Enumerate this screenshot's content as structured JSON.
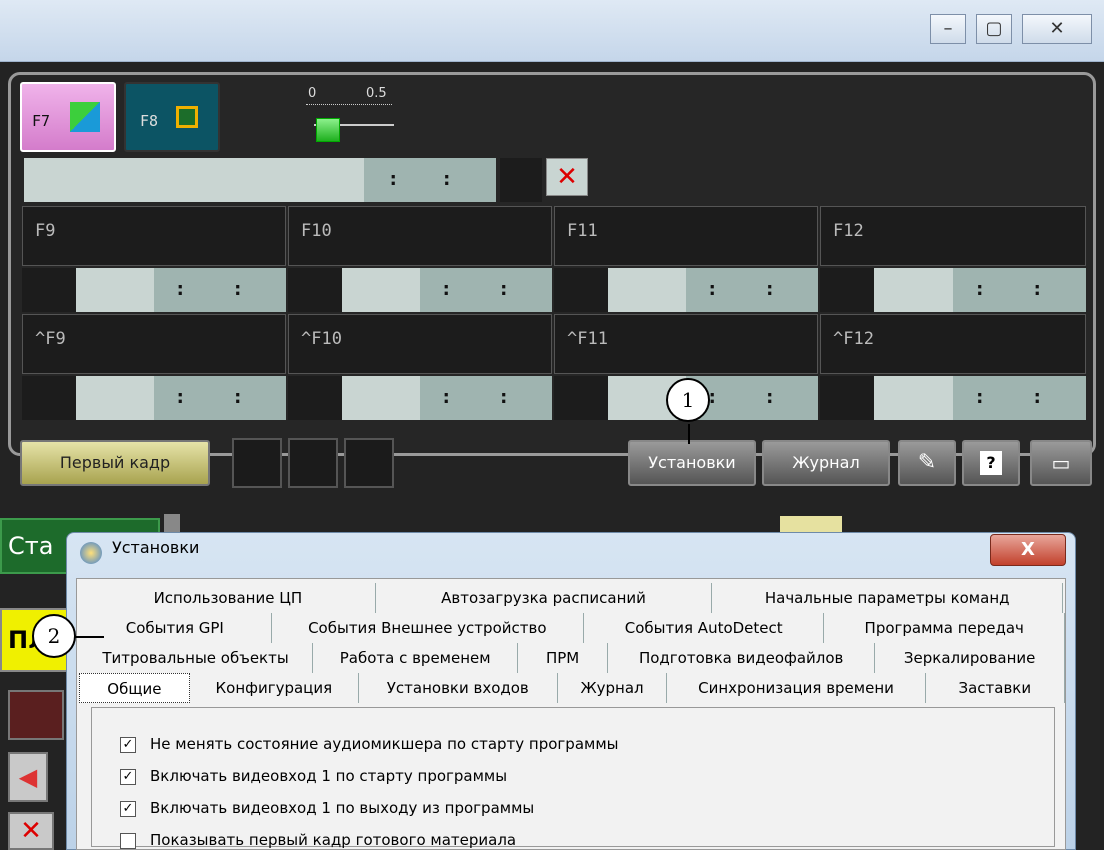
{
  "window": {
    "controls": [
      "–",
      "▢",
      "✕"
    ]
  },
  "toolbar": {
    "f7_label": "F7",
    "f8_label": "F8",
    "slider": {
      "min_label": "0",
      "max_label": "0.5",
      "level": 0.0
    }
  },
  "main_timer": ": :",
  "slots": [
    {
      "label": "F9"
    },
    {
      "label": "F10"
    },
    {
      "label": "F11"
    },
    {
      "label": "F12"
    },
    {
      "label": "^F9"
    },
    {
      "label": "^F10"
    },
    {
      "label": "^F11"
    },
    {
      "label": "^F12"
    }
  ],
  "slot_timer": ": :",
  "bottom_bar": {
    "first_frame": "Первый кадр",
    "settings": "Установки",
    "journal": "Журнал",
    "help": "?"
  },
  "left_fragments": {
    "sta": "Ста",
    "pl": "Пл"
  },
  "dialog": {
    "title": "Установки",
    "close": "X",
    "tab_rows": [
      [
        "Использование ЦП",
        "Автозагрузка расписаний",
        "Начальные параметры команд"
      ],
      [
        "События GPI",
        "События Внешнее устройство",
        "События AutoDetect",
        "Программа передач"
      ],
      [
        "Титровальные объекты",
        "Работа с временем",
        "ПРМ",
        "Подготовка видеофайлов",
        "Зеркалирование"
      ],
      [
        "Общие",
        "Конфигурация",
        "Установки входов",
        "Журнал",
        "Синхронизация времени",
        "Заставки"
      ]
    ],
    "options": [
      {
        "label": "Не менять состояние аудиомикшера по старту программы",
        "checked": true
      },
      {
        "label": "Включать видеовход 1 по старту программы",
        "checked": true
      },
      {
        "label": "Включать видеовход 1 по выходу из программы",
        "checked": true
      },
      {
        "label": "Показывать первый кадр готового материала",
        "checked": false
      }
    ]
  },
  "callouts": [
    "1",
    "2"
  ]
}
